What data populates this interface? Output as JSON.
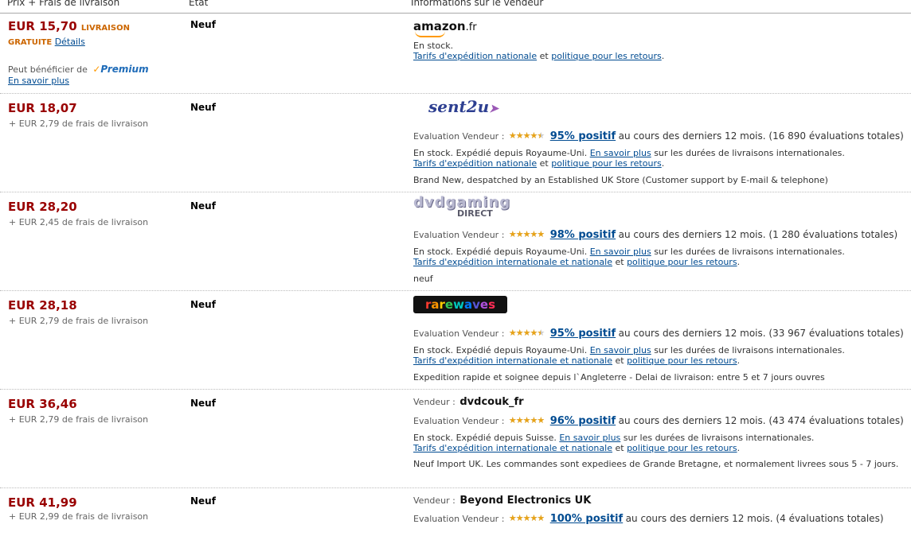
{
  "header": {
    "col_price": "Prix + Frais de livraison",
    "col_condition": "État",
    "col_seller": "Informations sur le vendeur"
  },
  "offers": [
    {
      "price": "EUR 15,70",
      "livraison": "LIVRAISON",
      "gratuite": "GRATUITE",
      "details_link": "Détails",
      "premium_text": "Peut bénéficier de",
      "premium_badge": "Premium",
      "premium_link": "En savoir plus",
      "condition": "Neuf",
      "logo": "amazon.fr",
      "logo_main": "amazon",
      "logo_suffix": ".fr",
      "stock": "En stock.",
      "ship_link1": "Tarifs d'expédition nationale",
      "and": "et",
      "ship_link2": "politique pour les retours",
      "dot": "."
    },
    {
      "price": "EUR 18,07",
      "shipping": "+ EUR 2,79 de frais de livraison",
      "condition": "Neuf",
      "logo": "sent2u",
      "rating_label": "Evaluation Vendeur :",
      "stars": 4.5,
      "pct": "95% positif",
      "rating_tail": "au cours des derniers 12 mois. (16 890 évaluations totales)",
      "stock": "En stock. Expédié depuis Royaume-Uni.",
      "learn_more": "En savoir plus",
      "learn_tail": "sur les durées de livraisons internationales.",
      "ship_link1": "Tarifs d'expédition nationale",
      "and": "et",
      "ship_link2": "politique pour les retours",
      "dot": ".",
      "note": "Brand New, despatched by an Established UK Store (Customer support by E-mail & telephone)"
    },
    {
      "price": "EUR 28,20",
      "shipping": "+ EUR 2,45 de frais de livraison",
      "condition": "Neuf",
      "logo_a": "dvdgaming",
      "logo_b": "DIRECT",
      "rating_label": "Evaluation Vendeur :",
      "stars": 5,
      "pct": "98% positif",
      "rating_tail": "au cours des derniers 12 mois. (1 280 évaluations totales)",
      "stock": "En stock. Expédié depuis Royaume-Uni.",
      "learn_more": "En savoir plus",
      "learn_tail": "sur les durées de livraisons internationales.",
      "ship_link1": "Tarifs d'expédition internationale et nationale",
      "and": "et",
      "ship_link2": "politique pour les retours",
      "dot": ".",
      "note": "neuf"
    },
    {
      "price": "EUR 28,18",
      "shipping": "+ EUR 2,79 de frais de livraison",
      "condition": "Neuf",
      "logo": "rarewaves",
      "rating_label": "Evaluation Vendeur :",
      "stars": 4.5,
      "pct": "95% positif",
      "rating_tail": "au cours des derniers 12 mois. (33 967 évaluations totales)",
      "stock": "En stock. Expédié depuis Royaume-Uni.",
      "learn_more": "En savoir plus",
      "learn_tail": "sur les durées de livraisons internationales.",
      "ship_link1": "Tarifs d'expédition internationale et nationale",
      "and": "et",
      "ship_link2": "politique pour les retours",
      "dot": ".",
      "note": "Expedition rapide et soignee depuis l`Angleterre - Delai de livraison: entre 5 et 7 jours ouvres"
    },
    {
      "price": "EUR 36,46",
      "shipping": "+ EUR 2,79 de frais de livraison",
      "condition": "Neuf",
      "seller_label": "Vendeur :",
      "seller_name": "dvdcouk_fr",
      "rating_label": "Evaluation Vendeur :",
      "stars": 5,
      "pct": "96% positif",
      "rating_tail": "au cours des derniers 12 mois. (43 474 évaluations totales)",
      "stock": "En stock. Expédié depuis Suisse.",
      "learn_more": "En savoir plus",
      "learn_tail": "sur les durées de livraisons internationales.",
      "ship_link1": "Tarifs d'expédition internationale et nationale",
      "and": "et",
      "ship_link2": "politique pour les retours",
      "dot": ".",
      "note": "Neuf Import UK. Les commandes sont expediees de Grande Bretagne, et normalement livrees sous 5 - 7 jours."
    },
    {
      "price": "EUR 41,99",
      "shipping": "+ EUR 2,99 de frais de livraison",
      "condition": "Neuf",
      "seller_label": "Vendeur :",
      "seller_name": "Beyond Electronics UK",
      "rating_label": "Evaluation Vendeur :",
      "stars": 5,
      "pct": "100% positif",
      "rating_tail": "au cours des derniers 12 mois. (4 évaluations totales)"
    }
  ],
  "colors": {
    "price": "#990000",
    "link": "#004b91",
    "free_shipping": "#cc6600",
    "star": "#e8a317"
  }
}
